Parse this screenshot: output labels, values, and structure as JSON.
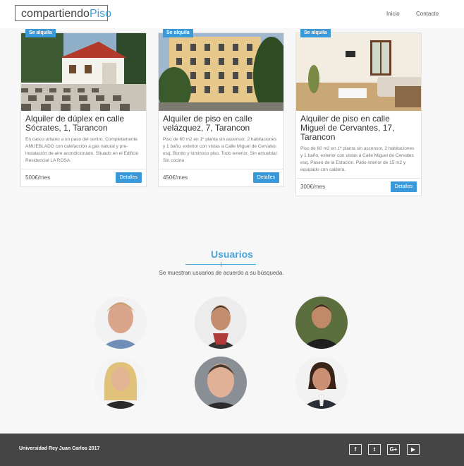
{
  "header": {
    "brand_part1": "compartiendo",
    "brand_part2": "Piso",
    "nav": [
      "Inicio",
      "Contacto"
    ]
  },
  "listings": [
    {
      "tag": "Se alquila",
      "title": "Alquiler de dúplex en calle Sócrates, 1, Tarancon",
      "description": "En casco urbano a un paso del centro. Completamente AMUEBLADO con calefacción a gas natural y pre-instalación de aire acondicionado. Situado en el Edificio Residencial LA ROSA.",
      "price": "500€/mes",
      "button": "Detalles"
    },
    {
      "tag": "Se alquila",
      "title": "Alquiler de piso en calle velázquez, 7, Tarancon",
      "description": "Piso de 60 m2 en 1º planta sin ascensor, 2 habitaciones y 1 baño, exterior con vistas a Calle Miguel de Cervates esq. Bonito y luminoso piso. Todo exterior. Sin amueblar. Sin cocina",
      "price": "450€/mes",
      "button": "Detalles"
    },
    {
      "tag": "Se alquila",
      "title": "Alquiler de piso en calle Miguel de Cervantes, 17, Tarancon",
      "description": "Piso de 60 m2 en 1º planta sin ascensor, 2 habitaciones y 1 baño, exterior con vistas a Calle Miguel de Cervates esq. Paseo de la Estación. Patio interior de 15 m2 y equipado con caldera.",
      "price": "300€/mes",
      "button": "Detalles"
    }
  ],
  "users": {
    "title": "Usuarios",
    "subtitle": "Se muestran usuarios de acuerdo a su búsqueda."
  },
  "footer": {
    "copyright": "Universidad Rey Juan Carlos 2017",
    "social": [
      {
        "icon": "facebook-icon",
        "glyph": "f"
      },
      {
        "icon": "twitter-icon",
        "glyph": "t"
      },
      {
        "icon": "google-plus-icon",
        "glyph": "G+"
      },
      {
        "icon": "youtube-icon",
        "glyph": "▶"
      }
    ]
  },
  "colors": {
    "accent": "#3a9ad9",
    "footer_bg": "#454545",
    "page_bg": "#f7f7f7"
  }
}
